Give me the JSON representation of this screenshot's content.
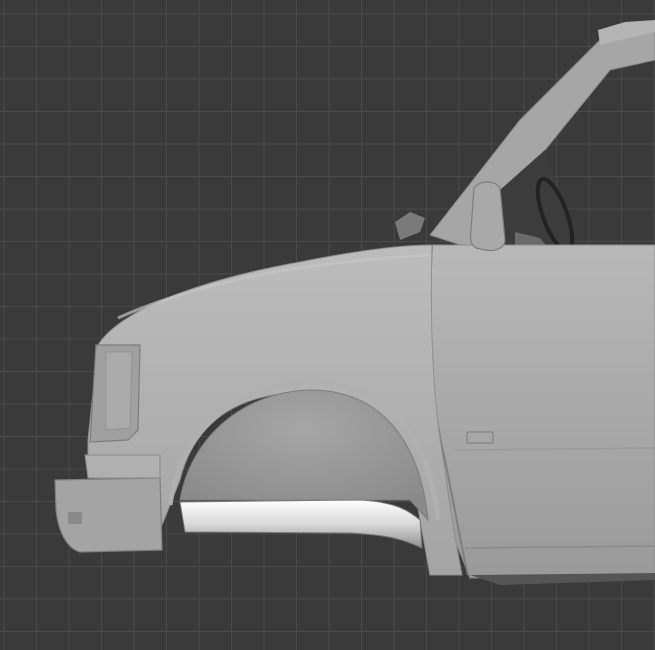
{
  "viewport": {
    "background": "#3a3a3a",
    "grid_line_color": "#4a4a4a",
    "grid_major_color": "#555555"
  },
  "model": {
    "body_color": "#a9a9a9",
    "body_shadow": "#8c8c8c",
    "body_highlight": "#bdbdbd",
    "wheel_well_color": "#979797",
    "chrome_color": "#e6e6e6",
    "interior_color": "#2c2c2c"
  }
}
